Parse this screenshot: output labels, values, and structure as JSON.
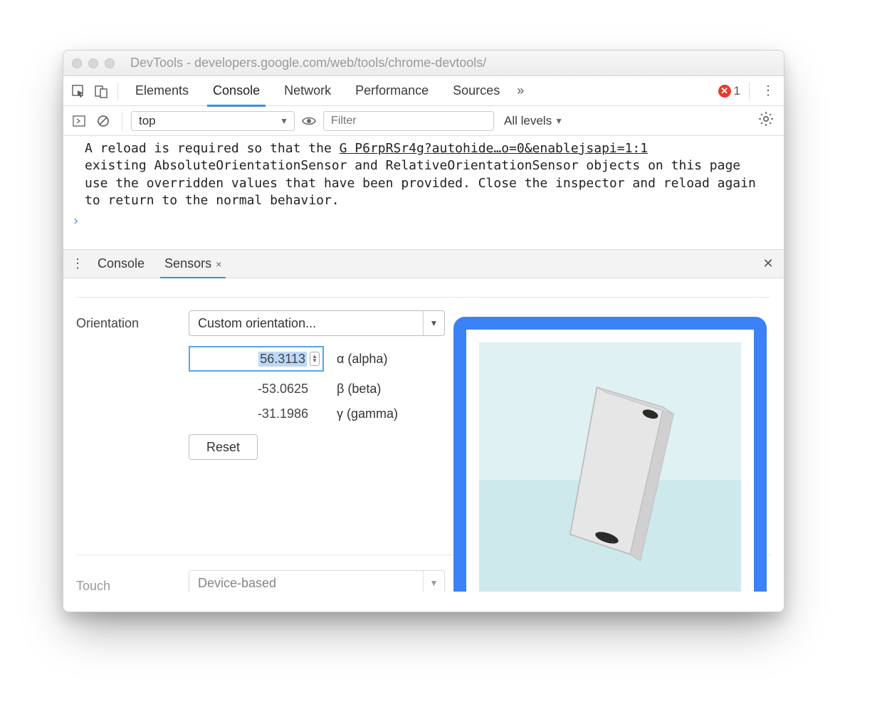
{
  "window": {
    "title": "DevTools - developers.google.com/web/tools/chrome-devtools/"
  },
  "tabs": {
    "items": [
      "Elements",
      "Console",
      "Network",
      "Performance",
      "Sources"
    ],
    "active": "Console",
    "more_glyph": "»",
    "errors": "1"
  },
  "console_toolbar": {
    "context": "top",
    "filter_placeholder": "Filter",
    "levels_label": "All levels",
    "levels_caret": "▼"
  },
  "console_message": {
    "text_prefix": "A reload is required so that the ",
    "source_link": "G P6rpRSr4g?autohide…o=0&enablejsapi=1:1",
    "text_rest": "existing AbsoluteOrientationSensor and RelativeOrientationSensor objects on this page use the overridden values that have been provided. Close the inspector and reload again to return to the normal behavior.",
    "prompt": "›"
  },
  "drawer": {
    "tabs": [
      "Console",
      "Sensors"
    ],
    "active": "Sensors",
    "close_glyph_small": "×",
    "close_glyph_big": "✕"
  },
  "sensors": {
    "orientation_label": "Orientation",
    "orientation_select": "Custom orientation...",
    "alpha_value": "56.3113",
    "alpha_label": "α (alpha)",
    "beta_value": "-53.0625",
    "beta_label": "β (beta)",
    "gamma_value": "-31.1986",
    "gamma_label": "γ (gamma)",
    "reset_label": "Reset",
    "touch_label": "Touch",
    "touch_select": "Device-based"
  }
}
